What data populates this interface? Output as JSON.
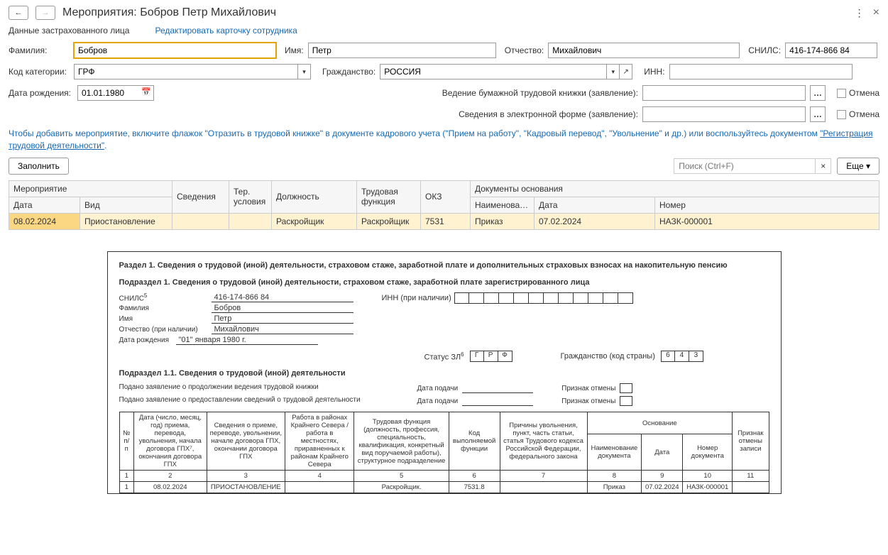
{
  "header": {
    "title": "Мероприятия: Бобров Петр Михайлович"
  },
  "subheader": {
    "label": "Данные застрахованного лица",
    "edit_link": "Редактировать карточку сотрудника"
  },
  "form": {
    "surname_lbl": "Фамилия:",
    "surname": "Бобров",
    "name_lbl": "Имя:",
    "name": "Петр",
    "patronymic_lbl": "Отчество:",
    "patronymic": "Михайлович",
    "snils_lbl": "СНИЛС:",
    "snils": "416-174-866 84",
    "category_lbl": "Код категории:",
    "category": "ГРФ",
    "citizenship_lbl": "Гражданство:",
    "citizenship": "РОССИЯ",
    "inn_lbl": "ИНН:",
    "inn": "",
    "dob_lbl": "Дата рождения:",
    "dob": "01.01.1980",
    "paper_app_lbl": "Ведение бумажной трудовой книжки (заявление):",
    "elec_app_lbl": "Сведения в электронной форме (заявление):",
    "cancel_lbl": "Отмена"
  },
  "info": {
    "text1": "Чтобы добавить мероприятие, включите флажок \"Отразить в трудовой книжке\" в документе кадрового учета (\"Прием на работу\", \"Кадровый перевод\", \"Увольнение\" и др.) или воспользуйтесь документом ",
    "link": "\"Регистрация трудовой деятельности\"",
    "text2": "."
  },
  "toolbar": {
    "fill_btn": "Заполнить",
    "search_ph": "Поиск (Ctrl+F)",
    "more_btn": "Еще"
  },
  "grid": {
    "headers": {
      "event": "Мероприятие",
      "info": "Сведения",
      "ter": "Тер. условия",
      "pos": "Должность",
      "func": "Трудовая функция",
      "okz": "ОКЗ",
      "docs": "Документы основания",
      "date": "Дата",
      "kind": "Вид",
      "doc_name": "Наименова…",
      "doc_date": "Дата",
      "doc_num": "Номер"
    },
    "row": {
      "date": "08.02.2024",
      "kind": "Приостановление",
      "info": "",
      "ter": "",
      "pos": "Раскройщик",
      "func": "Раскройщик",
      "okz": "7531",
      "doc_name": "Приказ",
      "doc_date": "07.02.2024",
      "doc_num": "НАЗК-000001"
    }
  },
  "printout": {
    "section_title": "Раздел 1. Сведения о трудовой (иной) деятельности, страховом стаже, заработной плате и дополнительных страховых взносах на накопительную пенсию",
    "subsection1": "Подраздел 1. Сведения о трудовой (иной) деятельности, страховом стаже, заработной плате зарегистрированного лица",
    "snils_lbl": "СНИЛС",
    "snils": "416-174-866 84",
    "surname_lbl": "Фамилия",
    "surname": "Бобров",
    "name_lbl": "Имя",
    "name": "Петр",
    "patr_lbl": "Отчество (при наличии)",
    "patronymic": "Михайлович",
    "dob_lbl": "Дата рождения",
    "dob": "\"01\" января 1980 г.",
    "inn_lbl": "ИНН (при наличии)",
    "status_lbl": "Статус ЗЛ",
    "status": [
      "Г",
      "Р",
      "Ф"
    ],
    "citizen_lbl": "Гражданство (код страны)",
    "citizen_code": [
      "6",
      "4",
      "3"
    ],
    "subsection11": "Подраздел 1.1. Сведения о трудовой (иной) деятельности",
    "app1": "Подано заявление о продолжении ведения трудовой книжки",
    "app2": "Подано заявление о предоставлении сведений о трудовой деятельности",
    "date_sub_lbl": "Дата подачи",
    "cancel_flag_lbl": "Признак отмены",
    "table_headers": {
      "num": "№ п/п",
      "date_col": "Дата (число, месяц, год) приема, перевода, увольнения, начала договора ГПХ⁷, окончания договора ГПХ",
      "info_col": "Сведения о приеме, переводе, увольнении, начале договора ГПХ, окончании договора ГПХ",
      "north_col": "Работа в районах Крайнего Севера / работа в местностях, приравненных к районам Крайнего Севера",
      "func_col": "Трудовая функция (должность, профессия, специальность, квалификация, конкретный вид поручаемой работы), структурное подразделение",
      "code_col": "Код выполняемой функции",
      "reason_col": "Причины увольнения, пункт, часть статьи, статья Трудового кодекса Российской Федерации, федерального закона",
      "basis": "Основание",
      "basis_name": "Наименование документа",
      "basis_date": "Дата",
      "basis_num": "Номер документа",
      "cancel_col": "Признак отмены записи"
    },
    "row": {
      "n": "1",
      "date": "08.02.2024",
      "info": "ПРИОСТАНОВЛЕНИЕ",
      "north": "",
      "func": "Раскройщик.",
      "code": "7531.8",
      "reason": "",
      "b_name": "Приказ",
      "b_date": "07.02.2024",
      "b_num": "НАЗК-000001",
      "cancel": ""
    },
    "colnums": [
      "1",
      "2",
      "3",
      "4",
      "5",
      "6",
      "7",
      "8",
      "9",
      "10",
      "11"
    ]
  }
}
